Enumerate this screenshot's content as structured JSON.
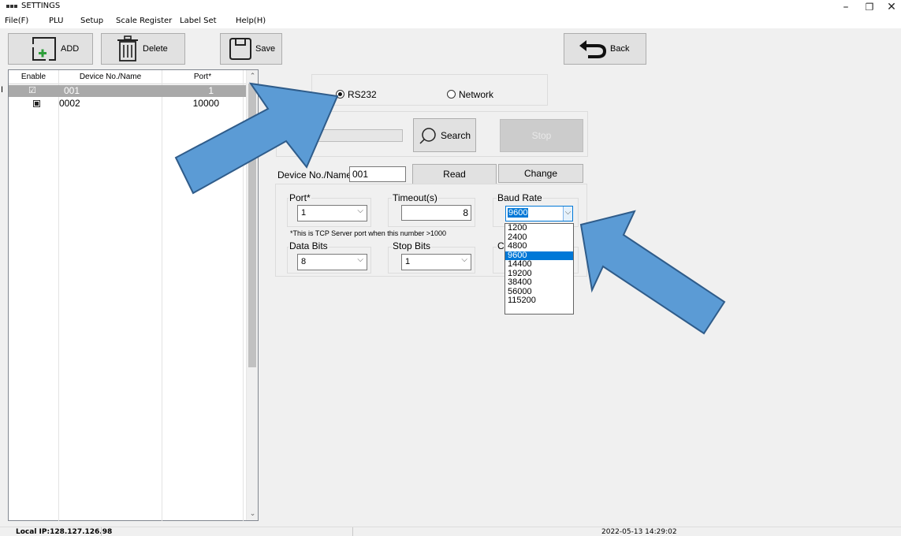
{
  "window": {
    "title": "SETTINGS",
    "minimize_symbol": "–",
    "restore_symbol": "❐",
    "close_symbol": "✕"
  },
  "menu": [
    "File(F)",
    "PLU",
    "Setup",
    "Scale Register",
    "Label Set",
    "Help(H)"
  ],
  "toolbar": {
    "add_label": "ADD",
    "delete_label": "Delete",
    "save_label": "Save",
    "back_label": "Back"
  },
  "device_list": {
    "columns": [
      "Enable",
      "Device No./Name",
      "Port*"
    ],
    "rows": [
      {
        "enabled": true,
        "name": "001",
        "port": "1",
        "selected": true
      },
      {
        "enabled": true,
        "name": "0002",
        "port": "10000",
        "selected": false
      }
    ]
  },
  "connection": {
    "rs232_label": "RS232",
    "network_label": "Network",
    "selected": "RS232",
    "search_label": "Search",
    "stop_label": "Stop"
  },
  "device": {
    "label": "Device No./Name",
    "value": "001",
    "read_label": "Read",
    "change_label": "Change"
  },
  "settings": {
    "port_label": "Port*",
    "port_value": "1",
    "timeout_label": "Timeout(s)",
    "timeout_value": "8",
    "baud_label": "Baud Rate",
    "baud_value": "9600",
    "tcp_note": "*This is TCP Server port when this number >1000",
    "databits_label": "Data Bits",
    "databits_value": "8",
    "stopbits_label": "Stop Bits",
    "stopbits_value": "1",
    "cr_label_partial": "Cr"
  },
  "baud_options": [
    "1200",
    "2400",
    "4800",
    "9600",
    "14400",
    "19200",
    "38400",
    "56000",
    "115200"
  ],
  "baud_highlighted": "9600",
  "status": {
    "local_ip": "Local IP:128.127.126.98",
    "datetime": "2022-05-13 14:29:02"
  },
  "colors": {
    "arrow_fill": "#5b9bd5",
    "arrow_stroke": "#2f5c8a",
    "selection": "#0078d7",
    "selected_row": "#a9a9a9"
  }
}
